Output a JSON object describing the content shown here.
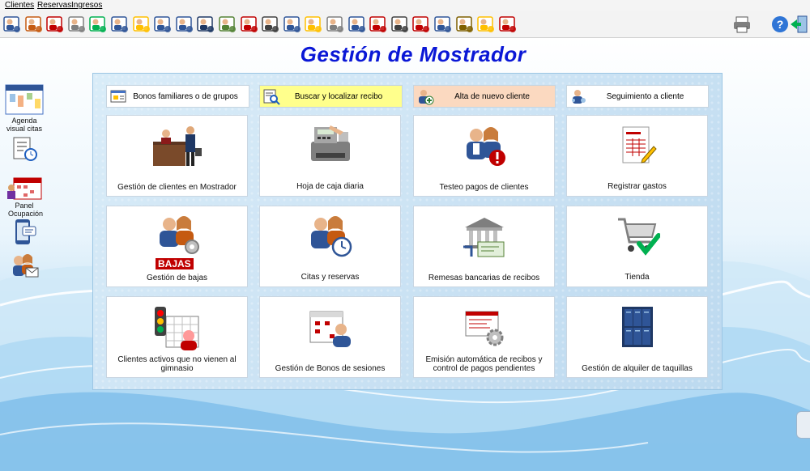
{
  "menu": [
    "Clientes",
    "Reservas",
    "Ingresos"
  ],
  "toolbar": {
    "icons": [
      "user-key-icon",
      "user-card-icon",
      "user-delete-icon",
      "document-list-icon",
      "clock-check-icon",
      "eye-clock-icon",
      "photo-ticket-icon",
      "search-user-icon",
      "user-screen-icon",
      "calendar-grid-icon",
      "calendar-clock-icon",
      "calendar-person-icon",
      "traffic-light-icon",
      "phone-list-icon",
      "photo-users-icon",
      "calculator-icon",
      "network-info-icon",
      "window-alert-icon",
      "fingerprint-icon",
      "turnstile-icon",
      "user-gear-icon",
      "dumbbell-icon",
      "user-sun-icon",
      "user-remove-icon"
    ],
    "right_icons": [
      "printer-icon",
      "help-icon",
      "exit-icon"
    ]
  },
  "title": "Gestión de Mostrador",
  "sidebar": {
    "items": [
      {
        "label": "Agenda visual citas",
        "icon": "visual-agenda-icon"
      },
      {
        "label": "",
        "icon": "checklist-clock-icon"
      },
      {
        "label": "Panel Ocupación",
        "icon": "occupancy-calendar-icon"
      },
      {
        "label": "",
        "icon": "mobile-message-icon"
      },
      {
        "label": "",
        "icon": "users-mail-icon"
      }
    ]
  },
  "header_buttons": [
    {
      "label": "Bonos familiares o de grupos",
      "icon": "group-voucher-icon",
      "color": "#ffffff"
    },
    {
      "label": "Buscar y localizar recibo",
      "icon": "search-receipt-icon",
      "color": "#ffff8c"
    },
    {
      "label": "Alta de nuevo cliente",
      "icon": "add-client-icon",
      "color": "#fbd9c0"
    },
    {
      "label": "Seguimiento a cliente",
      "icon": "client-followup-icon",
      "color": "#ffffff"
    }
  ],
  "cards": [
    {
      "label": "Gestión de clientes en Mostrador",
      "icon": "front-desk-icon"
    },
    {
      "label": "Hoja de caja diaria",
      "icon": "cash-register-icon"
    },
    {
      "label": "Testeo pagos de clientes",
      "icon": "clients-alert-icon"
    },
    {
      "label": "Registrar gastos",
      "icon": "expense-document-icon"
    },
    {
      "label": "Gestión de bajas",
      "icon": "cancellations-icon",
      "badge": "BAJAS"
    },
    {
      "label": "Citas y reservas",
      "icon": "appointments-clock-icon"
    },
    {
      "label": "Remesas bancarias de recibos",
      "icon": "bank-remittance-icon"
    },
    {
      "label": "Tienda",
      "icon": "shopping-cart-icon"
    },
    {
      "label": "Clientes activos que no vienen al gimnasio",
      "icon": "inactive-clients-icon"
    },
    {
      "label": "Gestión de Bonos de sesiones",
      "icon": "session-vouchers-icon"
    },
    {
      "label": "Emisión automática de recibos y control de pagos pendientes",
      "icon": "auto-receipts-icon"
    },
    {
      "label": "Gestión de alquiler de taquillas",
      "icon": "lockers-icon"
    }
  ],
  "colors": {
    "title": "#0a17d6",
    "accent_blue": "#1f5fbf"
  }
}
